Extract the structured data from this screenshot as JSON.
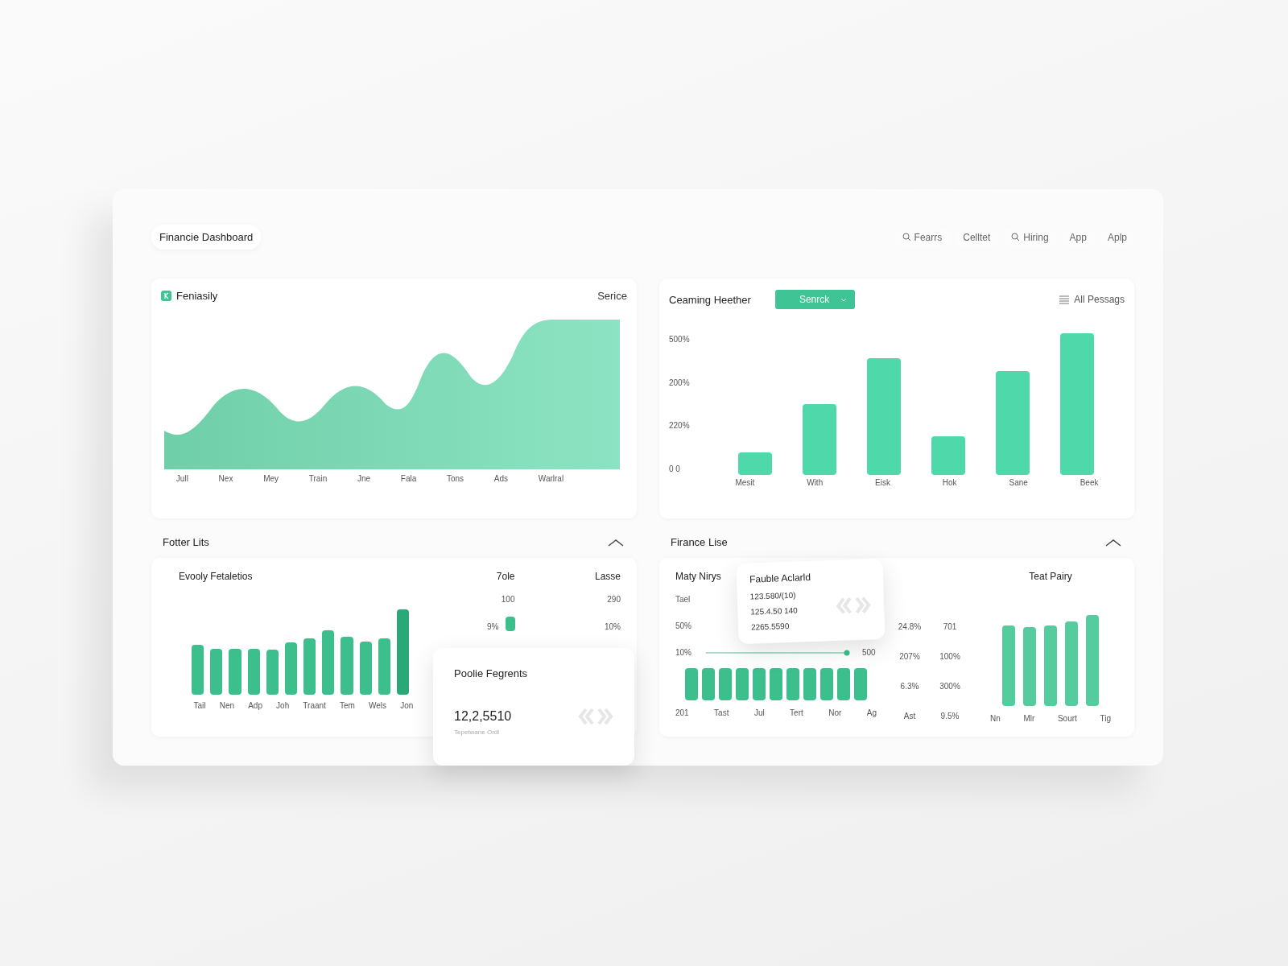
{
  "header": {
    "title": "Financie Dashboard",
    "nav": [
      {
        "label": "Fearrs",
        "kind": "search"
      },
      {
        "label": "Celltet",
        "kind": "plain"
      },
      {
        "label": "Hiring",
        "kind": "search"
      },
      {
        "label": "App",
        "kind": "plain"
      },
      {
        "label": "Aplp",
        "kind": "plain"
      }
    ]
  },
  "area_panel": {
    "title": "Feniasily",
    "action": "Serice",
    "x_labels": [
      "Jull",
      "Nex",
      "Mey",
      "Train",
      "Jne",
      "Fala",
      "Tons",
      "Ads",
      "Warlral"
    ]
  },
  "bar_panel": {
    "title": "Ceaming Heether",
    "dropdown": "Senrck",
    "filter": "All Pessags",
    "y_labels": [
      "500%",
      "200%",
      "220%",
      "0  0"
    ],
    "x_labels": [
      "Mesit",
      "With",
      "Eisk",
      "Hok",
      "Sane",
      "Beek"
    ]
  },
  "left_section": {
    "title": "Fotter Lits",
    "chart_title": "Evooly Fetaletios",
    "x_labels": [
      "Tail",
      "Nen",
      "Adp",
      "Joh",
      "Traant",
      "Tem",
      "Wels",
      "Jon"
    ],
    "table": {
      "columns": [
        "7ole",
        "Lasse"
      ],
      "rows": [
        [
          "100",
          "290"
        ],
        [
          "9%",
          "10%"
        ]
      ]
    },
    "popup": {
      "title": "Poolie Fegrents",
      "value": "12,2,5510",
      "caption": "Tepetwane Ordl"
    }
  },
  "right_section": {
    "title": "Firance Lise",
    "chart_title": "Maty Nirys",
    "y_labels": [
      "Tael",
      "50%",
      "10%"
    ],
    "line_value": "500",
    "x_labels": [
      "201",
      "Tast",
      "Jul",
      "Tert",
      "Nor",
      "Ag"
    ],
    "stats": [
      [
        "24.8%",
        "701"
      ],
      [
        "207%",
        "100%"
      ],
      [
        "6.3%",
        "300%"
      ],
      [
        "Ast",
        "9.5%"
      ]
    ],
    "side_title": "Teat Pairy",
    "side_labels": [
      "Nn",
      "Mlr",
      "Sourt",
      "Tig"
    ],
    "popup": {
      "title": "Fauble Aclarld",
      "lines": [
        "123.580/(10)",
        "125.4.50 140",
        "2265.5590"
      ]
    }
  }
}
